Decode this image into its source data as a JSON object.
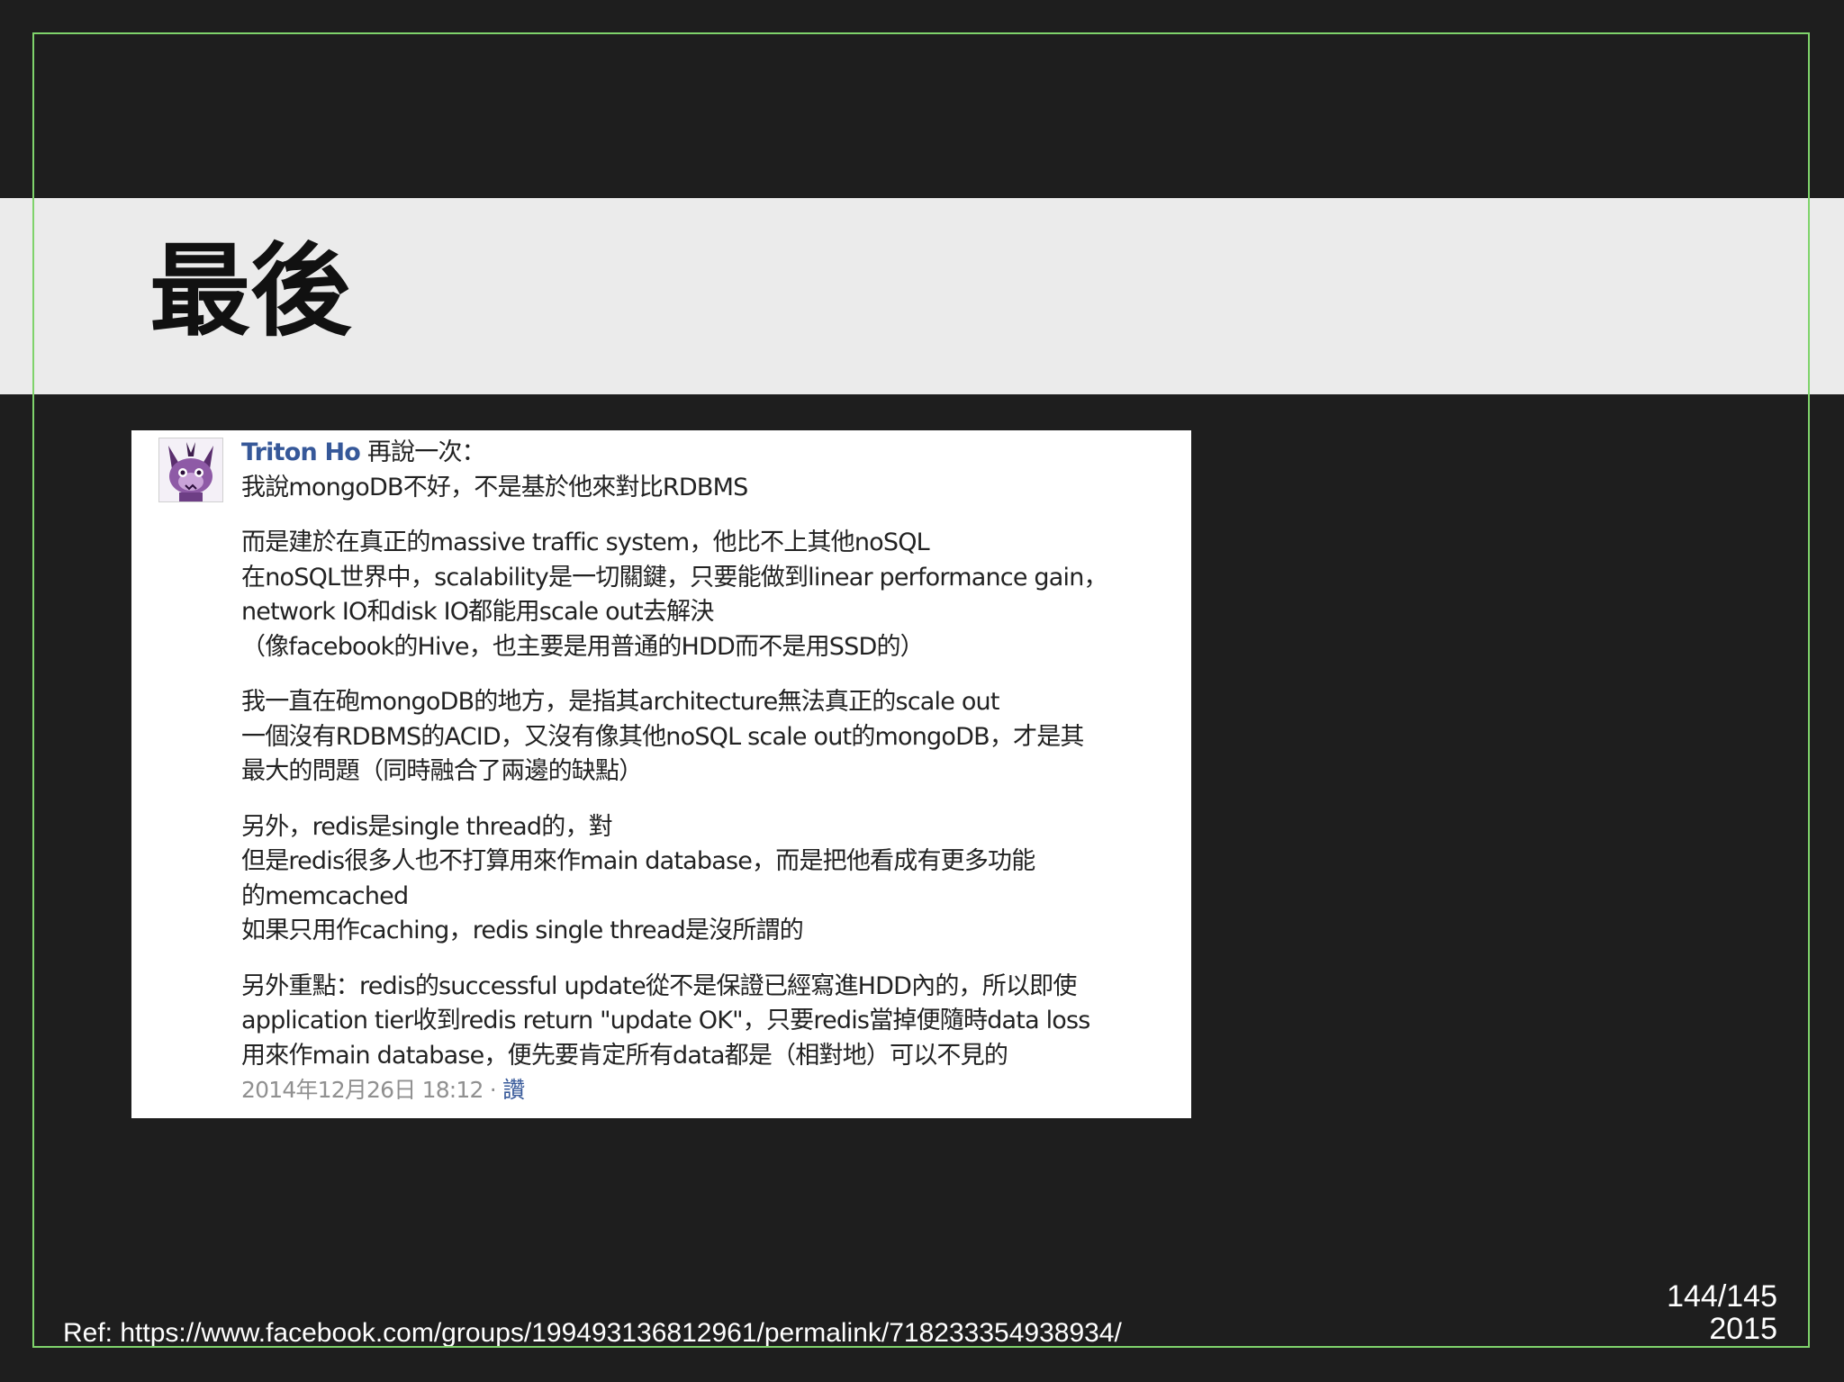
{
  "slide": {
    "title": "最後",
    "reference": "Ref: https://www.facebook.com/groups/199493136812961/permalink/718233354938934/",
    "page_number": "144/145",
    "year": "2015"
  },
  "post": {
    "avatar_icon": "purple-cat-avatar-icon",
    "author": "Triton Ho",
    "paragraphs": [
      {
        "lines": [
          "再說一次：",
          "我說mongoDB不好，不是基於他來對比RDBMS"
        ]
      },
      {
        "lines": [
          "而是建於在真正的massive traffic system，他比不上其他noSQL",
          "在noSQL世界中，scalability是一切關鍵，只要能做到linear performance gain，",
          "network IO和disk IO都能用scale out去解決",
          "（像facebook的Hive，也主要是用普通的HDD而不是用SSD的）"
        ]
      },
      {
        "lines": [
          "我一直在砲mongoDB的地方，是指其architecture無法真正的scale out",
          "一個沒有RDBMS的ACID，又沒有像其他noSQL scale out的mongoDB，才是其",
          "最大的問題（同時融合了兩邊的缺點）"
        ]
      },
      {
        "lines": [
          "另外，redis是single thread的，對",
          "但是redis很多人也不打算用來作main database，而是把他看成有更多功能",
          "的memcached",
          "如果只用作caching，redis single thread是沒所謂的"
        ]
      },
      {
        "lines": [
          "另外重點：redis的successful update從不是保證已經寫進HDD內的，所以即使",
          "application tier收到redis return \"update OK\"，只要redis當掉便隨時data loss",
          "用來作main database，便先要肯定所有data都是（相對地）可以不見的"
        ]
      }
    ],
    "timestamp": "2014年12月26日 18:12 · ",
    "action": "讚"
  },
  "colors": {
    "background": "#1e1e1e",
    "title_band": "#ebebeb",
    "frame": "#7fd36b",
    "author_link": "#365899",
    "timestamp": "#909090"
  }
}
